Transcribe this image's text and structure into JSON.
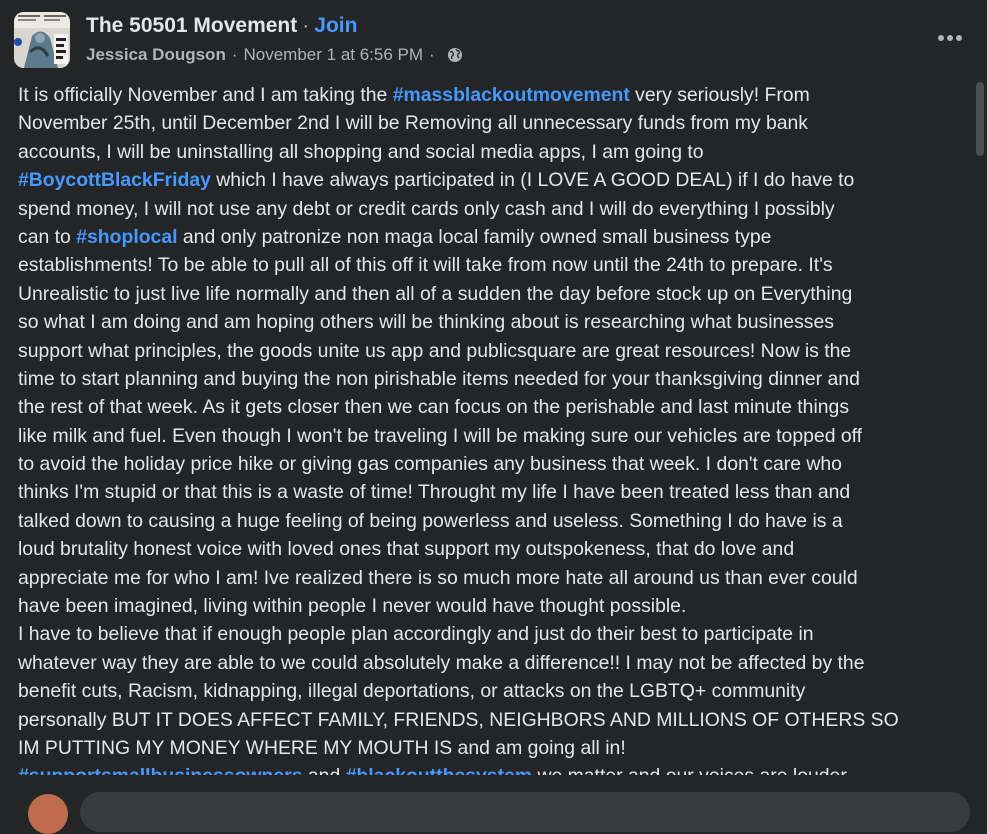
{
  "post": {
    "group_name": "The 50501 Movement",
    "separator": "·",
    "join_label": "Join",
    "author": "Jessica Dougson",
    "timestamp": "November 1 at 6:56 PM",
    "privacy_icon": "globe-icon",
    "more_icon": "more-horizontal-icon",
    "body_lines": [
      [
        {
          "t": "It is officially November and I am taking the "
        },
        {
          "t": "#massblackoutmovement",
          "tag": true
        },
        {
          "t": " very seriously! From"
        }
      ],
      [
        {
          "t": "November 25th, until December 2nd I will be Removing all unnecessary funds from my bank"
        }
      ],
      [
        {
          "t": "accounts, I will be uninstalling all shopping and social media apps, I am going to"
        }
      ],
      [
        {
          "t": "#BoycottBlackFriday",
          "tag": true
        },
        {
          "t": "  which I have always participated in (I LOVE A GOOD DEAL) if I do have to"
        }
      ],
      [
        {
          "t": "spend money, I will not use any debt or credit cards only cash and I will do everything I possibly"
        }
      ],
      [
        {
          "t": "can to "
        },
        {
          "t": "#shoplocal",
          "tag": true
        },
        {
          "t": " and only patronize non maga local family owned small business type"
        }
      ],
      [
        {
          "t": "establishments! To be able to pull all of this off it will take from now until the 24th to prepare. It's"
        }
      ],
      [
        {
          "t": "Unrealistic to just live life normally and then all of a sudden the day before stock up on Everything"
        }
      ],
      [
        {
          "t": "so what I am doing and am hoping others will be thinking about is researching what businesses"
        }
      ],
      [
        {
          "t": "support what principles, the goods unite us app and publicsquare are great resources! Now is the"
        }
      ],
      [
        {
          "t": "time to start planning and buying the non pirishable items needed for your thanksgiving dinner and"
        }
      ],
      [
        {
          "t": "the rest of that week. As it gets closer then we can focus on the perishable and last minute things"
        }
      ],
      [
        {
          "t": "like milk and fuel. Even though I won't be traveling I will be making sure our vehicles are topped off"
        }
      ],
      [
        {
          "t": "to avoid the holiday price hike or giving gas companies any business that week. I don't care who"
        }
      ],
      [
        {
          "t": "thinks I'm stupid or that this is a waste of time! Throught my life I have been treated less than and"
        }
      ],
      [
        {
          "t": "talked down to causing a huge feeling of being powerless and useless. Something I do have is a"
        }
      ],
      [
        {
          "t": "loud brutality honest voice with loved ones that support my outspokeness, that do love and"
        }
      ],
      [
        {
          "t": "appreciate me for who I am! Ive realized there is so much more hate all around us than ever could"
        }
      ],
      [
        {
          "t": "have been imagined, living within people I never would have thought possible."
        }
      ],
      [
        {
          "t": "I have to believe that if enough people plan accordingly and just do their best to participate in"
        }
      ],
      [
        {
          "t": "whatever way they are able to we could absolutely make a difference!! I may not be affected by the"
        }
      ],
      [
        {
          "t": "benefit cuts, Racism, kidnapping, illegal deportations, or attacks on the LGBTQ+ community"
        }
      ],
      [
        {
          "t": "personally BUT IT DOES AFFECT FAMILY, FRIENDS, NEIGHBORS AND MILLIONS OF OTHERS SO"
        }
      ],
      [
        {
          "t": "IM PUTTING MY MONEY WHERE MY MOUTH IS and am going all in!"
        }
      ],
      [
        {
          "t": "#supportsmallbusinessowners",
          "tag": true
        },
        {
          "t": " and "
        },
        {
          "t": "#blackoutthesystem",
          "tag": true
        },
        {
          "t": " we matter and our voices are louder"
        }
      ]
    ]
  },
  "colors": {
    "background": "#242526",
    "text": "#e4e6eb",
    "secondary_text": "#b0b3b8",
    "link": "#4599ff"
  }
}
